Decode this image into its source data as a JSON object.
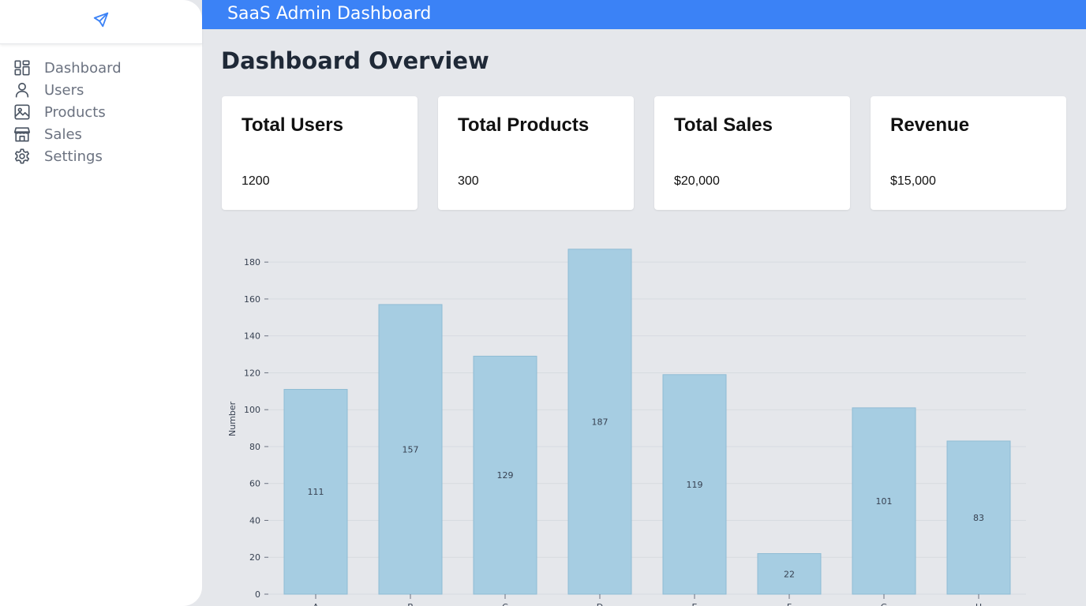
{
  "header": {
    "title": "SaaS Admin Dashboard"
  },
  "sidebar": {
    "logo_icon": "rocket-icon",
    "items": [
      {
        "label": "Dashboard",
        "icon": "dashboard-icon"
      },
      {
        "label": "Users",
        "icon": "user-icon"
      },
      {
        "label": "Products",
        "icon": "image-icon"
      },
      {
        "label": "Sales",
        "icon": "store-icon"
      },
      {
        "label": "Settings",
        "icon": "gear-icon"
      }
    ]
  },
  "main": {
    "title": "Dashboard Overview",
    "cards": [
      {
        "title": "Total Users",
        "value": "1200"
      },
      {
        "title": "Total Products",
        "value": "300"
      },
      {
        "title": "Total Sales",
        "value": "$20,000"
      },
      {
        "title": "Revenue",
        "value": "$15,000"
      }
    ]
  },
  "colors": {
    "accent": "#3b82f6",
    "bar_fill": "#a6cde2",
    "bar_stroke": "#8fbcd4"
  },
  "chart_data": {
    "type": "bar",
    "categories": [
      "A",
      "B",
      "C",
      "D",
      "E",
      "F",
      "G",
      "H"
    ],
    "values": [
      111,
      157,
      129,
      187,
      119,
      22,
      101,
      83
    ],
    "ylabel": "Number",
    "xlabel": "",
    "ylim": [
      0,
      190
    ],
    "yticks": [
      0,
      20,
      40,
      60,
      80,
      100,
      120,
      140,
      160,
      180
    ],
    "grid": true,
    "data_labels": true
  }
}
